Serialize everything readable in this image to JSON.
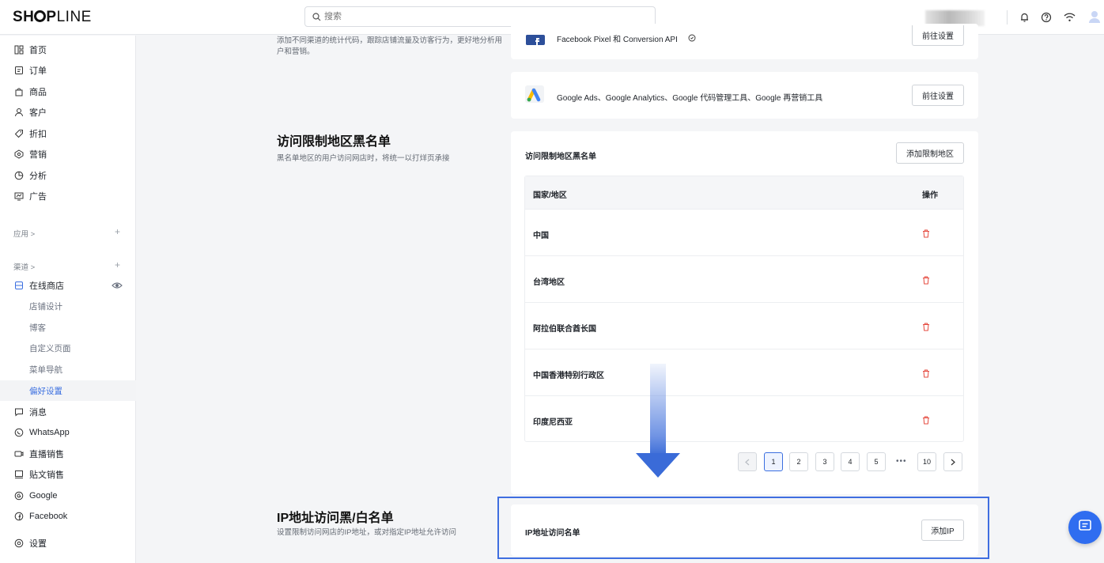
{
  "brand": {
    "logo_left": "SH",
    "logo_mid": "P",
    "logo_right": "LINE"
  },
  "search": {
    "placeholder": "搜索"
  },
  "sidebar": {
    "items": [
      {
        "label": "首页",
        "icon": "home-icon"
      },
      {
        "label": "订单",
        "icon": "order-icon"
      },
      {
        "label": "商品",
        "icon": "product-icon"
      },
      {
        "label": "客户",
        "icon": "customer-icon"
      },
      {
        "label": "折扣",
        "icon": "discount-icon"
      },
      {
        "label": "营销",
        "icon": "marketing-icon"
      },
      {
        "label": "分析",
        "icon": "analytics-icon"
      },
      {
        "label": "广告",
        "icon": "ads-icon"
      }
    ],
    "apps_group": "应用 >",
    "channels_group": "渠道 >",
    "online_store": "在线商店",
    "sub_items": [
      "店铺设计",
      "博客",
      "自定义页面",
      "菜单导航",
      "偏好设置"
    ],
    "channels": [
      {
        "label": "消息",
        "icon": "message-icon"
      },
      {
        "label": "WhatsApp",
        "icon": "whatsapp-icon"
      },
      {
        "label": "直播销售",
        "icon": "live-icon"
      },
      {
        "label": "贴文销售",
        "icon": "post-icon"
      },
      {
        "label": "Google",
        "icon": "google-icon"
      },
      {
        "label": "Facebook",
        "icon": "facebook-icon"
      }
    ],
    "settings": "设置"
  },
  "sections": {
    "tracking": {
      "desc": "添加不同渠道的统计代码，跟踪店铺流量及访客行为，更好地分析用户和营销。",
      "facebook_label": "Facebook Pixel 和 Conversion API",
      "facebook_btn": "前往设置",
      "google_label": "Google Ads、Google Analytics、Google 代码管理工具、Google 再营销工具",
      "google_btn": "前往设置"
    },
    "region_block": {
      "title": "访问限制地区黑名单",
      "desc": "黑名单地区的用户访问网店时，将统一以打烊页承接",
      "card_title": "访问限制地区黑名单",
      "add_btn": "添加限制地区",
      "col_country": "国家/地区",
      "col_action": "操作",
      "rows": [
        "中国",
        "台湾地区",
        "阿拉伯联合酋长国",
        "中国香港特别行政区",
        "印度尼西亚"
      ]
    },
    "pagination": {
      "pages": [
        "1",
        "2",
        "3",
        "4",
        "5",
        "10"
      ],
      "dots": "•••"
    },
    "ip_block": {
      "title": "IP地址访问黑/白名单",
      "desc": "设置限制访问网店的IP地址，或对指定IP地址允许访问",
      "card_title": "IP地址访问名单",
      "add_btn": "添加IP"
    }
  },
  "colors": {
    "accent": "#3b6fe0",
    "danger": "#e5483d",
    "highlight": "#3f6ee0"
  }
}
